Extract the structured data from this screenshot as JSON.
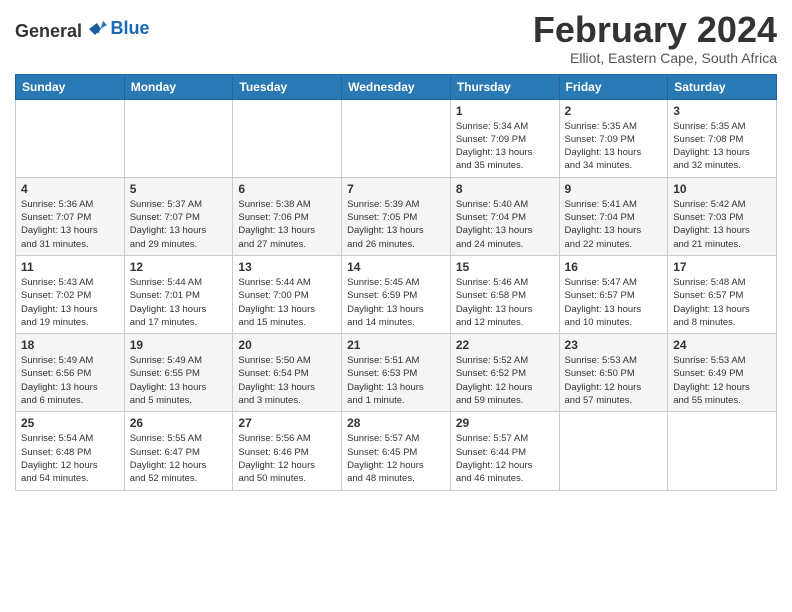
{
  "logo": {
    "general": "General",
    "blue": "Blue"
  },
  "title": "February 2024",
  "subtitle": "Elliot, Eastern Cape, South Africa",
  "days_header": [
    "Sunday",
    "Monday",
    "Tuesday",
    "Wednesday",
    "Thursday",
    "Friday",
    "Saturday"
  ],
  "weeks": [
    [
      {
        "day": "",
        "info": ""
      },
      {
        "day": "",
        "info": ""
      },
      {
        "day": "",
        "info": ""
      },
      {
        "day": "",
        "info": ""
      },
      {
        "day": "1",
        "info": "Sunrise: 5:34 AM\nSunset: 7:09 PM\nDaylight: 13 hours\nand 35 minutes."
      },
      {
        "day": "2",
        "info": "Sunrise: 5:35 AM\nSunset: 7:09 PM\nDaylight: 13 hours\nand 34 minutes."
      },
      {
        "day": "3",
        "info": "Sunrise: 5:35 AM\nSunset: 7:08 PM\nDaylight: 13 hours\nand 32 minutes."
      }
    ],
    [
      {
        "day": "4",
        "info": "Sunrise: 5:36 AM\nSunset: 7:07 PM\nDaylight: 13 hours\nand 31 minutes."
      },
      {
        "day": "5",
        "info": "Sunrise: 5:37 AM\nSunset: 7:07 PM\nDaylight: 13 hours\nand 29 minutes."
      },
      {
        "day": "6",
        "info": "Sunrise: 5:38 AM\nSunset: 7:06 PM\nDaylight: 13 hours\nand 27 minutes."
      },
      {
        "day": "7",
        "info": "Sunrise: 5:39 AM\nSunset: 7:05 PM\nDaylight: 13 hours\nand 26 minutes."
      },
      {
        "day": "8",
        "info": "Sunrise: 5:40 AM\nSunset: 7:04 PM\nDaylight: 13 hours\nand 24 minutes."
      },
      {
        "day": "9",
        "info": "Sunrise: 5:41 AM\nSunset: 7:04 PM\nDaylight: 13 hours\nand 22 minutes."
      },
      {
        "day": "10",
        "info": "Sunrise: 5:42 AM\nSunset: 7:03 PM\nDaylight: 13 hours\nand 21 minutes."
      }
    ],
    [
      {
        "day": "11",
        "info": "Sunrise: 5:43 AM\nSunset: 7:02 PM\nDaylight: 13 hours\nand 19 minutes."
      },
      {
        "day": "12",
        "info": "Sunrise: 5:44 AM\nSunset: 7:01 PM\nDaylight: 13 hours\nand 17 minutes."
      },
      {
        "day": "13",
        "info": "Sunrise: 5:44 AM\nSunset: 7:00 PM\nDaylight: 13 hours\nand 15 minutes."
      },
      {
        "day": "14",
        "info": "Sunrise: 5:45 AM\nSunset: 6:59 PM\nDaylight: 13 hours\nand 14 minutes."
      },
      {
        "day": "15",
        "info": "Sunrise: 5:46 AM\nSunset: 6:58 PM\nDaylight: 13 hours\nand 12 minutes."
      },
      {
        "day": "16",
        "info": "Sunrise: 5:47 AM\nSunset: 6:57 PM\nDaylight: 13 hours\nand 10 minutes."
      },
      {
        "day": "17",
        "info": "Sunrise: 5:48 AM\nSunset: 6:57 PM\nDaylight: 13 hours\nand 8 minutes."
      }
    ],
    [
      {
        "day": "18",
        "info": "Sunrise: 5:49 AM\nSunset: 6:56 PM\nDaylight: 13 hours\nand 6 minutes."
      },
      {
        "day": "19",
        "info": "Sunrise: 5:49 AM\nSunset: 6:55 PM\nDaylight: 13 hours\nand 5 minutes."
      },
      {
        "day": "20",
        "info": "Sunrise: 5:50 AM\nSunset: 6:54 PM\nDaylight: 13 hours\nand 3 minutes."
      },
      {
        "day": "21",
        "info": "Sunrise: 5:51 AM\nSunset: 6:53 PM\nDaylight: 13 hours\nand 1 minute."
      },
      {
        "day": "22",
        "info": "Sunrise: 5:52 AM\nSunset: 6:52 PM\nDaylight: 12 hours\nand 59 minutes."
      },
      {
        "day": "23",
        "info": "Sunrise: 5:53 AM\nSunset: 6:50 PM\nDaylight: 12 hours\nand 57 minutes."
      },
      {
        "day": "24",
        "info": "Sunrise: 5:53 AM\nSunset: 6:49 PM\nDaylight: 12 hours\nand 55 minutes."
      }
    ],
    [
      {
        "day": "25",
        "info": "Sunrise: 5:54 AM\nSunset: 6:48 PM\nDaylight: 12 hours\nand 54 minutes."
      },
      {
        "day": "26",
        "info": "Sunrise: 5:55 AM\nSunset: 6:47 PM\nDaylight: 12 hours\nand 52 minutes."
      },
      {
        "day": "27",
        "info": "Sunrise: 5:56 AM\nSunset: 6:46 PM\nDaylight: 12 hours\nand 50 minutes."
      },
      {
        "day": "28",
        "info": "Sunrise: 5:57 AM\nSunset: 6:45 PM\nDaylight: 12 hours\nand 48 minutes."
      },
      {
        "day": "29",
        "info": "Sunrise: 5:57 AM\nSunset: 6:44 PM\nDaylight: 12 hours\nand 46 minutes."
      },
      {
        "day": "",
        "info": ""
      },
      {
        "day": "",
        "info": ""
      }
    ]
  ]
}
